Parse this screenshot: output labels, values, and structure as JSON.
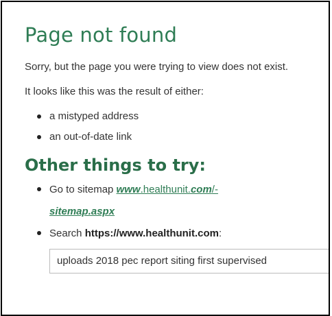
{
  "error": {
    "title": "Page not found",
    "message": "Sorry, but the page you were trying to view does not exist.",
    "reason_intro": "It looks like this was the result of either:",
    "reasons": [
      "a mistyped address",
      "an out-of-date link"
    ]
  },
  "try": {
    "heading": "Other things to try:",
    "sitemap": {
      "prefix": "Go to sitemap ",
      "link_part1": "www",
      "link_part2": ".healthunit.",
      "link_part3": "com",
      "link_part4": "/-",
      "link_part5": "sitemap.aspx"
    },
    "search": {
      "prefix": "Search ",
      "site": "https://www.healthunit.com",
      "suffix": ":",
      "value": "uploads 2018 pec report siting first supervised"
    }
  }
}
